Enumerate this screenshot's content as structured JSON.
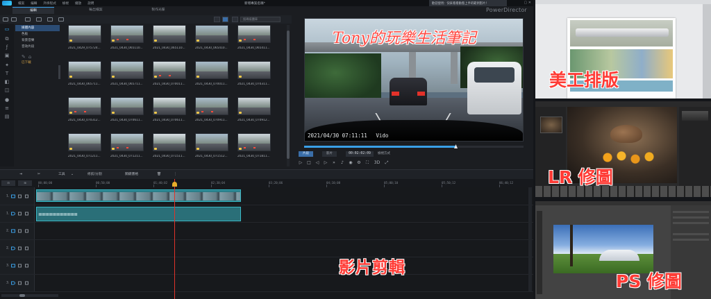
{
  "app": {
    "brand": "PowerDirector",
    "project_title": "新增專案名稱*",
    "menu": [
      "檔案",
      "編輯",
      "外掛程式",
      "檢視",
      "播放",
      "說明"
    ],
    "notification": "歡迎使用：快來看看動態上手的範例影片！"
  },
  "mode_tabs": [
    "編輯",
    "輸出檔案",
    "製作光碟"
  ],
  "library": {
    "search_placeholder": "搜尋媒體庫",
    "tree": [
      {
        "label": "媒體內容",
        "selected": true
      },
      {
        "label": "色板",
        "selected": false
      },
      {
        "label": "背景音樂",
        "selected": false
      },
      {
        "label": "音效片段",
        "selected": false
      },
      {
        "label": "已下載",
        "selected": false,
        "accent": true
      }
    ],
    "clips": [
      "2021_0429_075724...",
      "2021_0430_065110...",
      "2021_0430_065110...",
      "2021_0430_065410...",
      "2021_0430_065411...",
      "2021_0430_065711...",
      "2021_0430_065711...",
      "2021_0430_070011...",
      "2021_0430_070011...",
      "2021_0430_070311...",
      "2021_0430_070312...",
      "2021_0430_070611...",
      "2021_0430_070611...",
      "2021_0430_070911...",
      "2021_0430_070912...",
      "2021_0430_071211...",
      "2021_0430_071211...",
      "2021_0430_071511...",
      "2021_0430_071512...",
      "2021_0430_071811..."
    ]
  },
  "preview": {
    "watermark": "Tony的玩樂生活筆記",
    "timestamp": "2021/04/30 07:11:11",
    "timestamp_tag": "Vido",
    "mode_clip": "片段",
    "mode_project": "影片",
    "timecode": "00:02:02:09",
    "quality": "檢視方式",
    "three_d": "3D",
    "progress_pct": 69
  },
  "timeline_toolbar": {
    "tools": "工具",
    "split": "修剪/分割",
    "keyframe": "關鍵畫格",
    "delete_icon": "trash-icon"
  },
  "ruler_ticks": [
    "00;00;00",
    "00;50;00",
    "01;40;02",
    "02;30;04",
    "03;20;06",
    "04;10;08",
    "05;00;10",
    "05;50;12",
    "06;40;12"
  ],
  "tracks": [
    {
      "label": "1.",
      "kind": "video"
    },
    {
      "label": "1.",
      "kind": "audio"
    },
    {
      "label": "2.",
      "kind": "video"
    },
    {
      "label": "2.",
      "kind": "audio"
    },
    {
      "label": "3.",
      "kind": "video"
    },
    {
      "label": "3.",
      "kind": "audio"
    }
  ],
  "timeline_clip_audio_label": "2021_0429_075724.MP4",
  "captions": {
    "video_edit": "影片剪輯",
    "layout": "美工排版",
    "lr": "LR 修圖",
    "ps": "PS 修圖"
  }
}
